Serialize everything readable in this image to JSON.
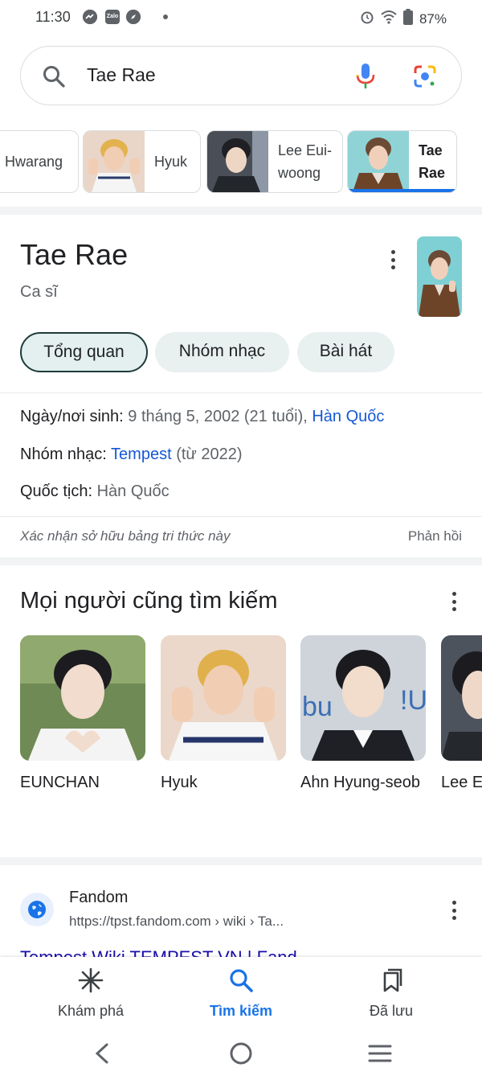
{
  "status_bar": {
    "time": "11:30",
    "app_icon_zalo": "Zalo",
    "battery": "87%",
    "icons": [
      "messenger-icon",
      "zalo-icon",
      "compass-icon",
      "alarm-icon",
      "wifi-icon",
      "battery-icon"
    ]
  },
  "search": {
    "query": "Tae Rae",
    "icons": [
      "search-icon",
      "mic-icon",
      "lens-icon"
    ]
  },
  "entity_strip": [
    {
      "label": "Hwarang",
      "has_thumb": false
    },
    {
      "label": "Hyuk",
      "has_thumb": true
    },
    {
      "label": "Lee Eui-woong",
      "has_thumb": true
    },
    {
      "label": "Tae Rae",
      "has_thumb": true,
      "active": true
    }
  ],
  "knowledge_panel": {
    "title": "Tae Rae",
    "subtitle": "Ca sĩ",
    "tabs": [
      "Tổng quan",
      "Nhóm nhạc",
      "Bài hát"
    ],
    "active_tab": "Tổng quan",
    "facts": [
      {
        "label": "Ngày/nơi sinh:",
        "value": "9 tháng 5, 2002 (21 tuổi),",
        "link": "Hàn Quốc"
      },
      {
        "label": "Nhóm nhạc:",
        "link": "Tempest",
        "value": "(từ 2022)"
      },
      {
        "label": "Quốc tịch:",
        "value": "Hàn Quốc"
      }
    ],
    "claim_text": "Xác nhận sở hữu bảng tri thức này",
    "feedback": "Phản hồi"
  },
  "people_also_search": {
    "title": "Mọi người cũng tìm kiếm",
    "people": [
      {
        "name": "EUNCHAN"
      },
      {
        "name": "Hyuk"
      },
      {
        "name": "Ahn Hyung-seob"
      },
      {
        "name": "Lee E"
      }
    ]
  },
  "result": {
    "site": "Fandom",
    "url": "https://tpst.fandom.com › wiki › Ta...",
    "title_peek": "Tempest Wiki TEMPEST VN | Fand"
  },
  "bottom_nav": {
    "items": [
      {
        "label": "Khám phá",
        "icon": "discover-icon"
      },
      {
        "label": "Tìm kiếm",
        "icon": "search-icon",
        "active": true
      },
      {
        "label": "Đã lưu",
        "icon": "saved-icon"
      }
    ]
  },
  "colors": {
    "accent": "#1a73e8",
    "link": "#1558d6",
    "chip_bg": "#e8f0f0",
    "active_tab_border": "#1e3b3b"
  }
}
